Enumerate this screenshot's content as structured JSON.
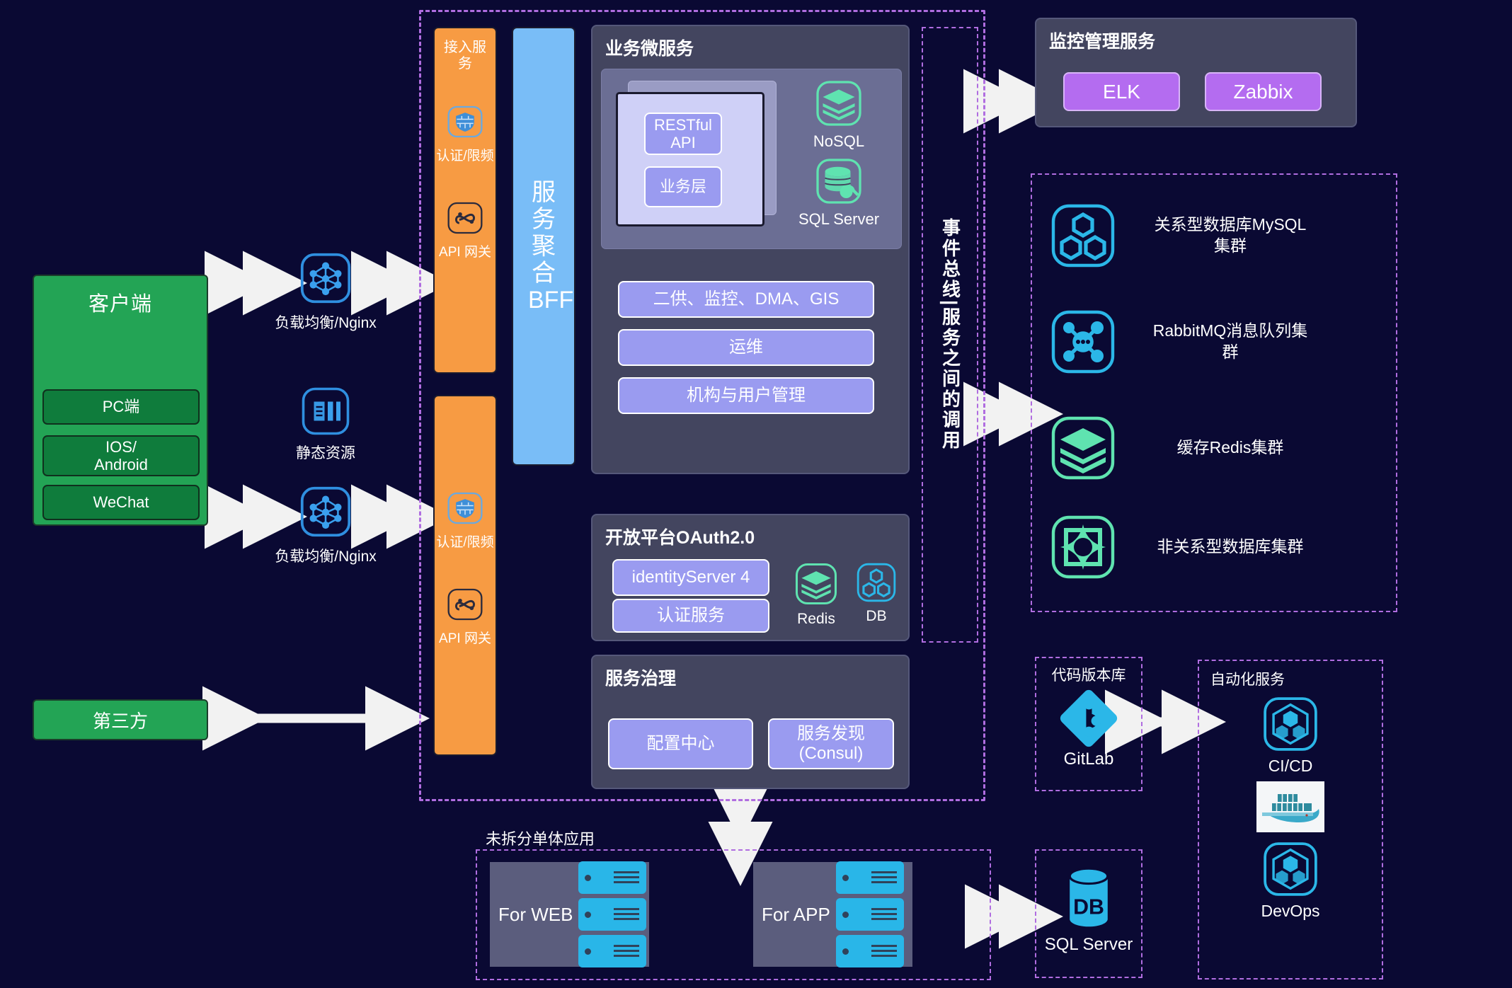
{
  "client": {
    "title": "客户端",
    "items": [
      "PC端",
      "IOS/\nAndroid",
      "WeChat"
    ],
    "third_party": "第三方"
  },
  "edge": {
    "lb_top": "负载均衡/Nginx",
    "static_res": "静态资源",
    "lb_bottom": "负载均衡/Nginx"
  },
  "access": {
    "col_title": "接入服务",
    "auth": "认证/限频",
    "gateway": "API 网关"
  },
  "bff": {
    "label": "服务聚合BFF"
  },
  "microservices": {
    "title": "业务微服务",
    "restful_api": "RESTful\nAPI",
    "business_layer": "业务层",
    "nosql": "NoSQL",
    "sqlserver": "SQL Server",
    "bars": [
      "二供、监控、DMA、GIS",
      "运维",
      "机构与用户管理"
    ]
  },
  "oauth": {
    "title": "开放平台OAuth2.0",
    "identity_server": "identityServer 4",
    "auth_service": "认证服务",
    "redis": "Redis",
    "db": "DB"
  },
  "governance": {
    "title": "服务治理",
    "config_center": "配置中心",
    "service_discovery": "服务发现\n(Consul)"
  },
  "event_bus": {
    "label": "事件总线|服务之间的调用"
  },
  "monitoring": {
    "title": "监控管理服务",
    "chips": [
      "ELK",
      "Zabbix"
    ]
  },
  "data_services": [
    {
      "label": "关系型数据库MySQL\n集群",
      "icon": "hexagon-cluster-icon",
      "color": "#2bb7e8"
    },
    {
      "label": "RabbitMQ消息队列集\n群",
      "icon": "rabbitmq-icon",
      "color": "#2bb7e8"
    },
    {
      "label": "缓存Redis集群",
      "icon": "layers-icon",
      "color": "#5fe3b0"
    },
    {
      "label": "非关系型数据库集群",
      "icon": "diamond-star-icon",
      "color": "#5fe3b0"
    }
  ],
  "monolith": {
    "title": "未拆分单体应用",
    "groups": [
      {
        "label": "For WEB",
        "servers": 3
      },
      {
        "label": "For APP",
        "servers": 3
      }
    ]
  },
  "repo": {
    "title": "代码版本库",
    "gitlab": "GitLab"
  },
  "db_bottom": {
    "label": "SQL Server",
    "badge": "DB"
  },
  "automation": {
    "title": "自动化服务",
    "items": [
      "CI/CD",
      "DevOps"
    ],
    "docker_icon": "docker-whale-icon"
  },
  "colors": {
    "background": "#0a0933",
    "green": "#23a455",
    "orange": "#f79b43",
    "bff_blue": "#79bdf7",
    "panel_grey": "#43455f",
    "purple_bar": "#9a9bf0",
    "dashed_purple": "#b06de0",
    "icon_cyan": "#2bb7e8",
    "icon_mint": "#5fe3b0",
    "monitor_chip": "#b46cf0"
  }
}
